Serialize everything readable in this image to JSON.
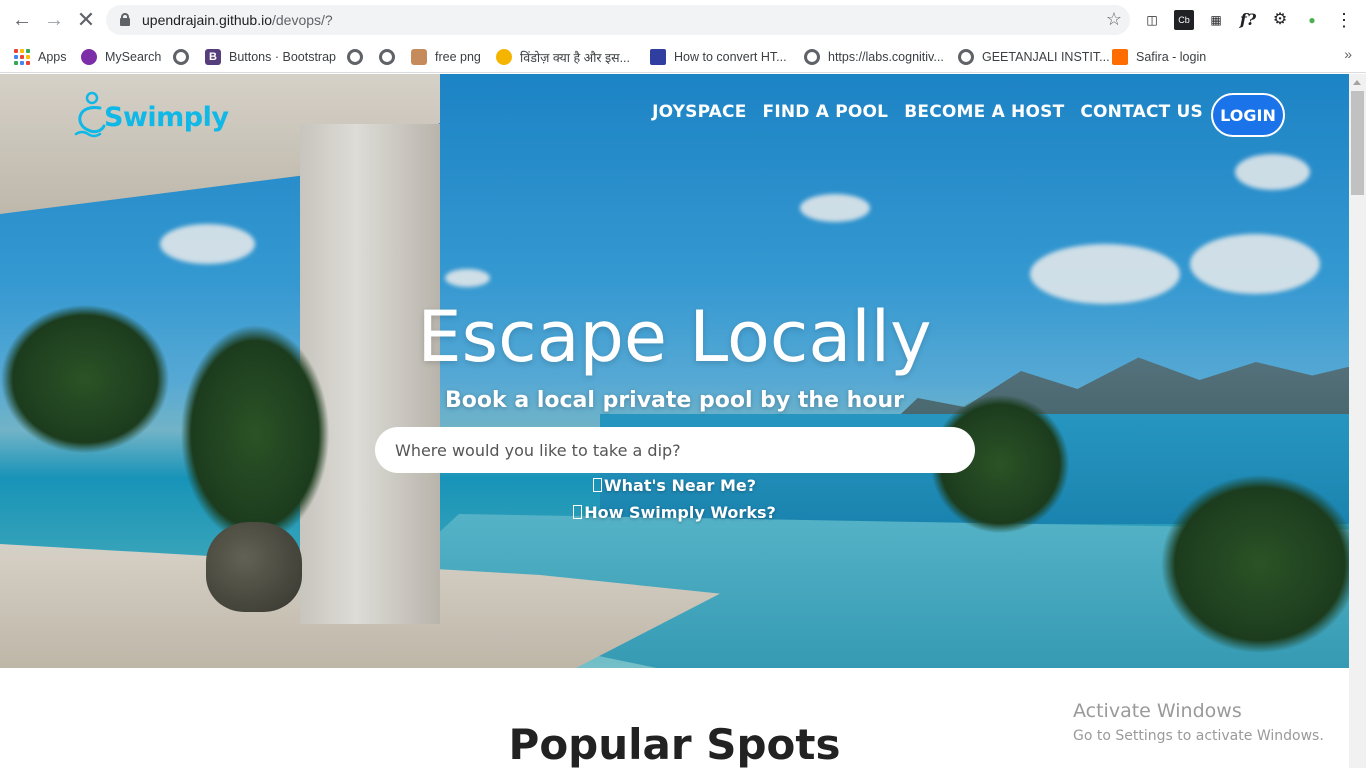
{
  "browser": {
    "url_host": "upendrajain.github.io",
    "url_path": "/devops/?",
    "extensions": [
      "screen-icon",
      "cb-icon",
      "translate-icon",
      "f?",
      "puzzle-icon",
      "globe-icon",
      "menu-icon"
    ]
  },
  "bookmarks": [
    {
      "label": "Apps",
      "icon": "apps-grid-icon"
    },
    {
      "label": "MySearch",
      "icon": "mysearch-icon"
    },
    {
      "label": "",
      "icon": "globe-icon"
    },
    {
      "label": "Buttons · Bootstrap",
      "icon": "bootstrap-icon"
    },
    {
      "label": "",
      "icon": "globe-icon"
    },
    {
      "label": "",
      "icon": "globe-icon"
    },
    {
      "label": "free png",
      "icon": "figure-icon"
    },
    {
      "label": "विंडोज़ क्या है और इस...",
      "icon": "m-icon"
    },
    {
      "label": "How to convert HT...",
      "icon": "square-icon"
    },
    {
      "label": "https://labs.cognitiv...",
      "icon": "globe-icon"
    },
    {
      "label": "GEETANJALI INSTIT...",
      "icon": "globe-icon"
    },
    {
      "label": "Safira - login",
      "icon": "h-icon"
    }
  ],
  "site": {
    "logo": "Swimply",
    "nav": [
      "JOYSPACE",
      "FIND A POOL",
      "BECOME A HOST",
      "CONTACT US"
    ],
    "login": "LOGIN",
    "headline": "Escape Locally",
    "subhead": "Book a local private pool by the hour",
    "search_placeholder": "Where would you like to take a dip?",
    "link_near": "What's Near Me?",
    "link_how": "How Swimply Works?",
    "section_title": "Popular Spots"
  },
  "watermark": {
    "line1": "Activate Windows",
    "line2": "Go to Settings to activate Windows."
  },
  "colors": {
    "accent": "#1a73e8",
    "logo": "#0fb8e6"
  }
}
